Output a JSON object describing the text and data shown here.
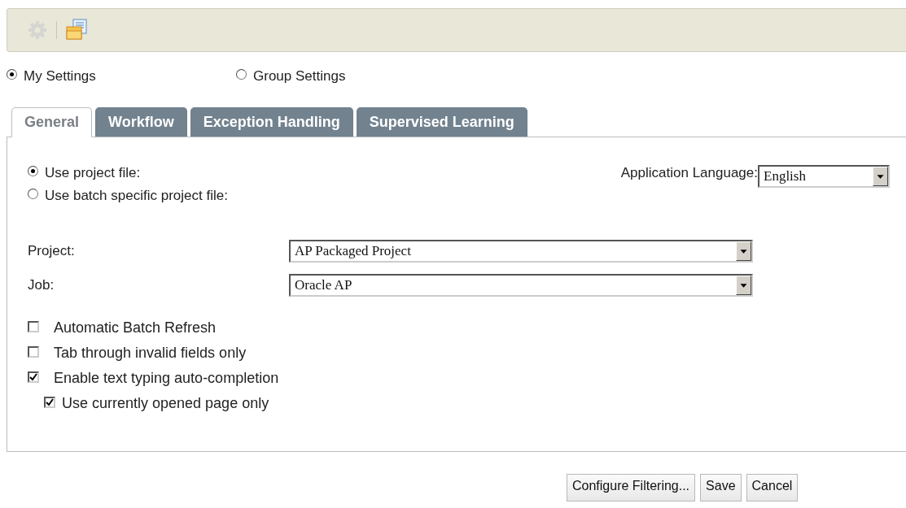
{
  "toolbar": {
    "items": [
      {
        "kind": "gear",
        "disabled": true
      },
      {
        "kind": "separator"
      },
      {
        "kind": "folder",
        "disabled": false
      }
    ]
  },
  "scope": [
    {
      "label": "My Settings",
      "selected": true
    },
    {
      "label": "Group Settings",
      "selected": false
    }
  ],
  "tabs": [
    {
      "label": "General",
      "selected": true
    },
    {
      "label": "Workflow",
      "selected": false
    },
    {
      "label": "Exception Handling",
      "selected": false
    },
    {
      "label": "Supervised Learning",
      "selected": false
    }
  ],
  "project_source": [
    {
      "label": "Use project file:",
      "selected": true
    },
    {
      "label": "Use batch specific project file:",
      "selected": false
    }
  ],
  "language": {
    "label": "Application Language:",
    "value": "English"
  },
  "fields": [
    {
      "label": "Project:",
      "value": "AP Packaged Project"
    },
    {
      "label": "Job:",
      "value": "Oracle AP"
    }
  ],
  "options": [
    {
      "label": "Automatic Batch Refresh",
      "checked": false
    },
    {
      "label": "Tab through invalid fields only",
      "checked": false
    },
    {
      "label": "Enable text typing auto-completion",
      "checked": true,
      "children": [
        {
          "label": "Use currently opened page only",
          "checked": true
        }
      ]
    }
  ],
  "buttons": [
    "Configure Filtering...",
    "Save",
    "Cancel"
  ]
}
